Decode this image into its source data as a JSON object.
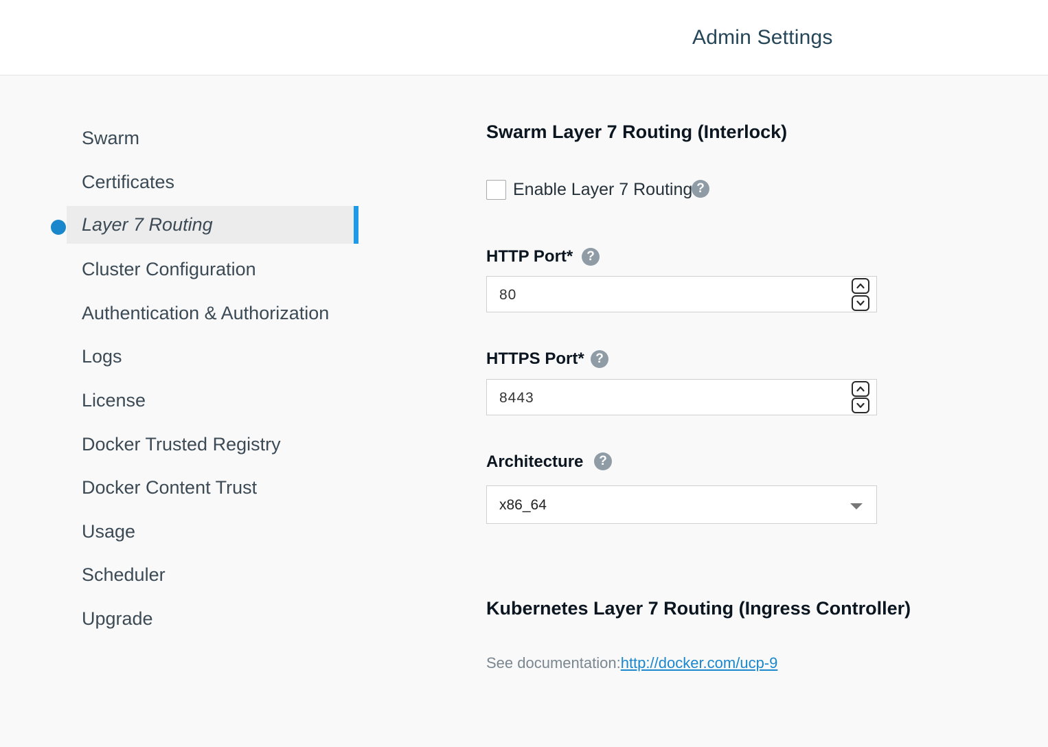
{
  "header": {
    "title": "Admin Settings"
  },
  "sidebar": {
    "items": [
      {
        "label": "Swarm"
      },
      {
        "label": "Certificates"
      },
      {
        "label": "Layer 7 Routing",
        "active": true
      },
      {
        "label": "Cluster Configuration"
      },
      {
        "label": "Authentication & Authorization"
      },
      {
        "label": "Logs"
      },
      {
        "label": "License"
      },
      {
        "label": "Docker Trusted Registry"
      },
      {
        "label": "Docker Content Trust"
      },
      {
        "label": "Usage"
      },
      {
        "label": "Scheduler"
      },
      {
        "label": "Upgrade"
      }
    ]
  },
  "main": {
    "swarm_title": "Swarm Layer 7 Routing (Interlock)",
    "enable": {
      "label": "Enable Layer 7 Routing",
      "checked": false
    },
    "http_port": {
      "label": "HTTP Port*",
      "value": "80"
    },
    "https_port": {
      "label": "HTTPS Port*",
      "value": "8443"
    },
    "architecture": {
      "label": "Architecture",
      "value": "x86_64"
    },
    "kube_title": "Kubernetes Layer 7 Routing (Ingress Controller)",
    "doc": {
      "prefix": "See documentation:",
      "link": "http://docker.com/ucp-9"
    },
    "help_glyph": "?"
  },
  "colors": {
    "accent": "#1d9be9",
    "dot": "#1a87cc",
    "title": "#254659"
  }
}
